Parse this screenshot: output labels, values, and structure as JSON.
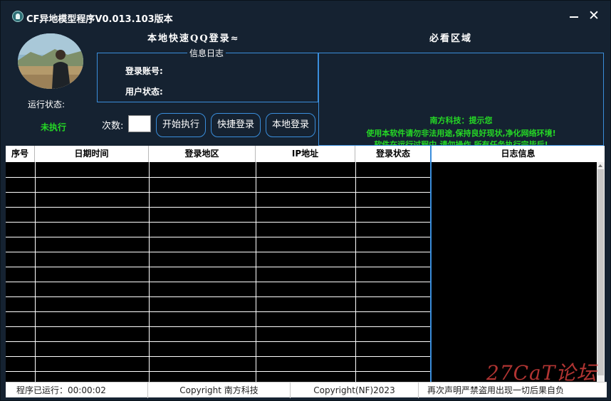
{
  "window": {
    "title": "CF异地模型程序V0.013.103版本",
    "close_glyph": "✕"
  },
  "headers": {
    "local_login": "本地快速QQ登录≈",
    "must_read": "必看区域"
  },
  "status": {
    "label": "运行状态:",
    "value": "未执行"
  },
  "info_log": {
    "title": "信息日志",
    "account_label": "登录账号:",
    "user_status_label": "用户状态:"
  },
  "notice": {
    "line1": "南方科技：提示您",
    "line2": "使用本软件请勿非法用途,保持良好现状,净化网络环境!",
    "line3": "软件在运行过程中,请勿操作,所有任务执行完毕后!"
  },
  "controls": {
    "count_label": "次数:",
    "count_value": "",
    "start_button": "开始执行",
    "quick_login_button": "快捷登录",
    "local_login_button": "本地登录"
  },
  "table": {
    "columns": [
      "序号",
      "日期时间",
      "登录地区",
      "IP地址",
      "登录状态"
    ],
    "rows": []
  },
  "log": {
    "title": "日志信息"
  },
  "statusbar": {
    "uptime": "程序已运行：00:00:02",
    "copyright1": "Copyright 南方科技",
    "copyright2": "Copyright(NF)2023",
    "disclaimer": "再次声明严禁盗用出现一切后果自负"
  },
  "watermark": {
    "text": "27CaT论坛"
  },
  "colors": {
    "background": "#152231",
    "accent_border": "#3a8edc",
    "status_green": "#25d825",
    "watermark_red": "#e24240"
  }
}
